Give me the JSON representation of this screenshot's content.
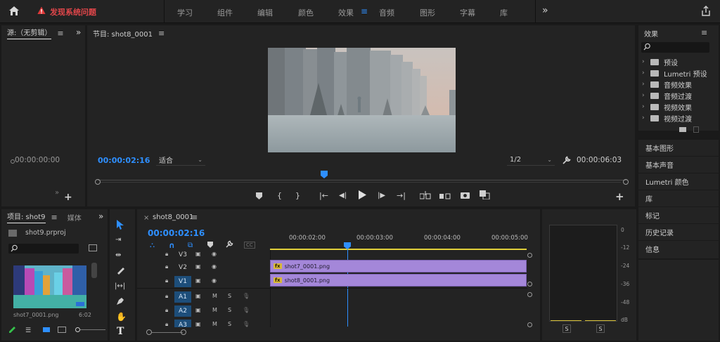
{
  "topbar": {
    "warning": "发现系统问题",
    "workspaces": [
      "学习",
      "组件",
      "编辑",
      "颜色",
      "效果",
      "音频",
      "图形",
      "字幕",
      "库"
    ],
    "active_workspace": "效果",
    "more": "»"
  },
  "source": {
    "title": "源:（无剪辑）",
    "timecode": "00:00:00:00"
  },
  "program": {
    "title": "节目: shot8_0001",
    "timecode": "00:00:02:16",
    "fit": "适合",
    "resolution": "1/2",
    "duration": "00:00:06:03"
  },
  "effects": {
    "title": "效果",
    "items": [
      "预设",
      "Lumetri 预设",
      "音频效果",
      "音频过渡",
      "视频效果",
      "视频过渡"
    ],
    "panels": [
      "基本图形",
      "基本声音",
      "Lumetri 颜色",
      "库",
      "标记",
      "历史记录",
      "信息"
    ]
  },
  "project": {
    "tab1": "项目: shot9",
    "tab2": "媒体",
    "file": "shot9.prproj",
    "thumb_name": "shot7_0001.png",
    "thumb_dur": "6:02"
  },
  "timeline": {
    "tab": "shot8_0001",
    "timecode": "00:00:02:16",
    "ruler": [
      "00:00:02:00",
      "00:00:03:00",
      "00:00:04:00",
      "00:00:05:00"
    ],
    "tracks": [
      {
        "name": "V3",
        "type": "video",
        "on": false
      },
      {
        "name": "V2",
        "type": "video",
        "on": false
      },
      {
        "name": "V1",
        "type": "video",
        "on": true
      },
      {
        "name": "A1",
        "type": "audio",
        "on": true
      },
      {
        "name": "A2",
        "type": "audio",
        "on": true
      },
      {
        "name": "A3",
        "type": "audio",
        "on": true
      }
    ],
    "clips": [
      {
        "name": "shot7_0001.png",
        "track": "V2"
      },
      {
        "name": "shot8_0001.png",
        "track": "V1"
      }
    ],
    "m": "M",
    "s": "S",
    "fx": "fx"
  },
  "meter": {
    "scale": [
      "0",
      "-12",
      "-24",
      "-36",
      "-48",
      "dB"
    ],
    "solo": [
      "S",
      "S"
    ]
  }
}
